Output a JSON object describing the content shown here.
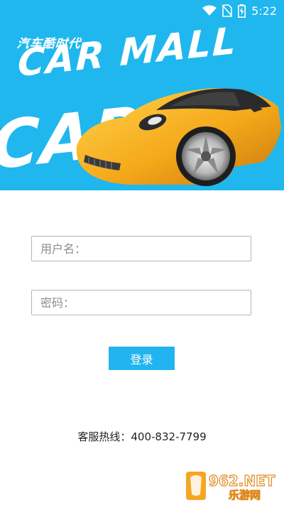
{
  "status_bar": {
    "time": "5:22",
    "icons": [
      "wifi-icon",
      "no-sim-icon",
      "battery-charging-icon"
    ]
  },
  "banner": {
    "slogan": "汽车酷时代",
    "brand": "CAR MALL",
    "brand_large": "CAR"
  },
  "login": {
    "username_placeholder": "用户名：",
    "password_placeholder": "密码：",
    "submit_label": "登录"
  },
  "footer": {
    "hotline": "客服热线：400-832-7799"
  },
  "watermark": {
    "logo_text": "962.NET",
    "sub_text": "乐游网"
  },
  "colors": {
    "brand_blue": "#1fb7ee",
    "button_blue": "#22b4f0",
    "car_yellow": "#f5b21c"
  }
}
